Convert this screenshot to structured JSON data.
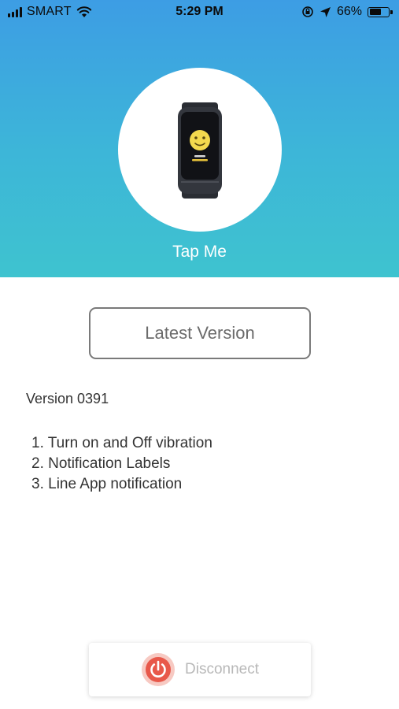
{
  "status_bar": {
    "carrier": "SMART",
    "time": "5:29 PM",
    "battery_percent": "66%",
    "battery_level": 0.66,
    "icons": [
      "signal-icon",
      "wifi-icon",
      "orientation-lock-icon",
      "location-icon",
      "battery-icon"
    ]
  },
  "header": {
    "device_image": "fitness-band-icon",
    "tap_label": "Tap Me",
    "gradient_top": "#3d9de4",
    "gradient_bottom": "#3ec3cf"
  },
  "main": {
    "latest_button_label": "Latest Version",
    "version_text": "Version 0391",
    "changes": [
      "1. Turn on and Off vibration",
      "2. Notification Labels",
      "3. Line App notification"
    ]
  },
  "footer": {
    "disconnect_label": "Disconnect",
    "power_icon": "power-icon",
    "accent": "#e8584a"
  }
}
